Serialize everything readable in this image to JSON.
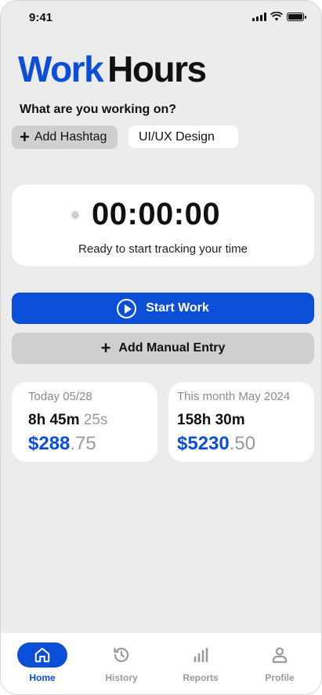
{
  "status_bar": {
    "time": "9:41"
  },
  "app": {
    "logo_part1": "Work",
    "logo_part2": "Hours"
  },
  "tracker": {
    "prompt": "What are you working on?",
    "add_hashtag_label": "Add Hashtag",
    "current_tag": "UI/UX Design"
  },
  "timer": {
    "value": "00:00:00",
    "caption": "Ready to start tracking your time"
  },
  "actions": {
    "start_label": "Start Work",
    "manual_label": "Add Manual Entry"
  },
  "stats": {
    "today": {
      "label": "Today 05/28",
      "hours": "8h 45m",
      "seconds": "25s",
      "amount_main": "$288",
      "amount_cents": ".75"
    },
    "month": {
      "label": "This month May 2024",
      "hours": "158h 30m",
      "amount_main": "$5230",
      "amount_cents": ".50"
    }
  },
  "tabs": [
    {
      "label": "Home",
      "icon": "home-icon",
      "active": true
    },
    {
      "label": "History",
      "icon": "history-icon",
      "active": false
    },
    {
      "label": "Reports",
      "icon": "bar-chart-icon",
      "active": false
    },
    {
      "label": "Profile",
      "icon": "person-icon",
      "active": false
    }
  ],
  "colors": {
    "accent": "#0b4fd8",
    "background": "#ececec",
    "muted": "#9a9a9a"
  }
}
